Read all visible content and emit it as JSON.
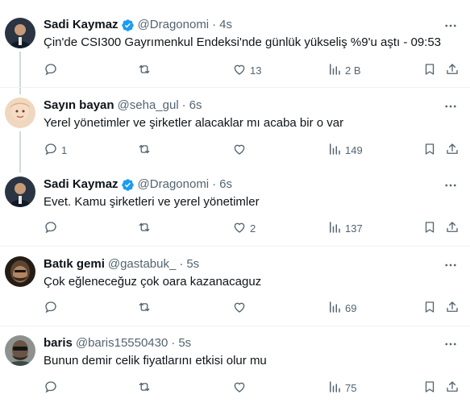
{
  "tweets": [
    {
      "name": "Sadi Kaymaz",
      "verified": true,
      "handle": "@Dragonomi",
      "dot": "·",
      "time": "4s",
      "text": "Çin'de CSI300 Gayrımenkul Endeksi'nde günlük yükseliş %9'u aştı - 09:53",
      "replies": "",
      "retweets": "",
      "likes": "13",
      "views": "2 B",
      "avatar_color": "#1d2a3a"
    },
    {
      "name": "Sayın bayan",
      "verified": false,
      "handle": "@seha_gul",
      "dot": "·",
      "time": "6s",
      "text": "Yerel yönetimler ve şirketler alacaklar mı acaba bir o var",
      "replies": "1",
      "retweets": "",
      "likes": "",
      "views": "149",
      "avatar_color": "#e8c9a8"
    },
    {
      "name": "Sadi Kaymaz",
      "verified": true,
      "handle": "@Dragonomi",
      "dot": "·",
      "time": "6s",
      "text": "Evet. Kamu şirketleri ve yerel yönetimler",
      "replies": "",
      "retweets": "",
      "likes": "2",
      "views": "137",
      "avatar_color": "#1d2a3a"
    },
    {
      "name": "Batık gemi",
      "verified": false,
      "handle": "@gastabuk_",
      "dot": "·",
      "time": "5s",
      "text": "Çok eğleneceğuz çok oara kazanacaguz",
      "replies": "",
      "retweets": "",
      "likes": "",
      "views": "69",
      "avatar_color": "#3b2f25"
    },
    {
      "name": "baris",
      "verified": false,
      "handle": "@baris15550430",
      "dot": "·",
      "time": "5s",
      "text": "Bunun demir celik fiyatlarını etkisi olur mu",
      "replies": "",
      "retweets": "",
      "likes": "",
      "views": "75",
      "avatar_color": "#7a7f7c"
    }
  ],
  "colors": {
    "verified_badge": "#1d9bf0",
    "muted": "#536471",
    "text": "#0f1419",
    "separator": "#eff3f4",
    "thread_line": "#cfd9de"
  },
  "icons": [
    "reply-icon",
    "retweet-icon",
    "like-icon",
    "views-icon",
    "bookmark-icon",
    "share-icon",
    "more-icon",
    "verified-icon"
  ]
}
